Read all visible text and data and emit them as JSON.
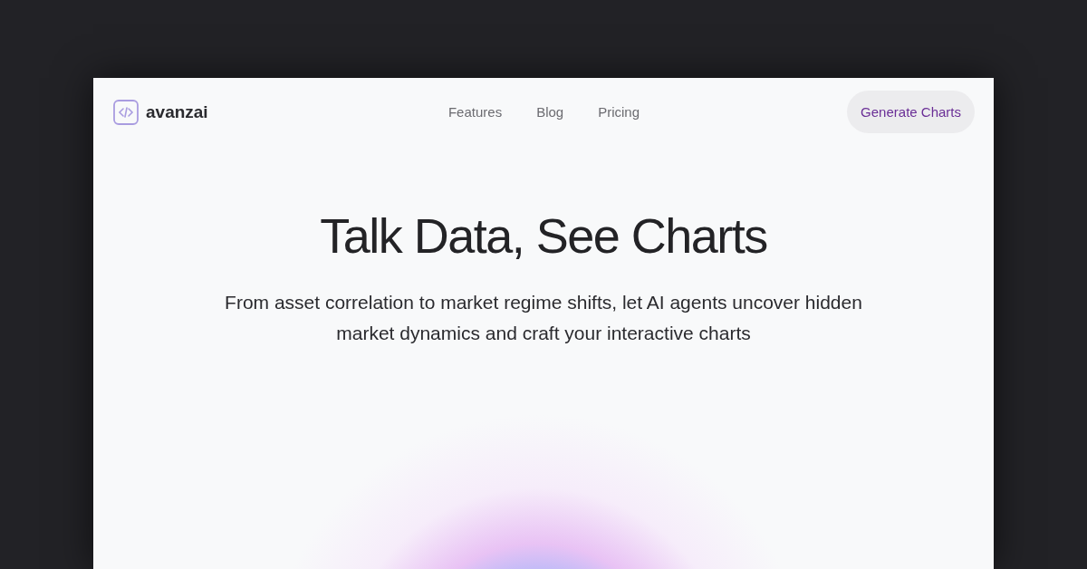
{
  "brand": {
    "name": "avanzai"
  },
  "nav": [
    {
      "label": "Features"
    },
    {
      "label": "Blog"
    },
    {
      "label": "Pricing"
    }
  ],
  "cta": {
    "label": "Generate Charts"
  },
  "hero": {
    "title": "Talk Data, See Charts",
    "subtitle": "From asset correlation to market regime shifts, let AI agents uncover hidden market dynamics and craft your interactive charts"
  }
}
